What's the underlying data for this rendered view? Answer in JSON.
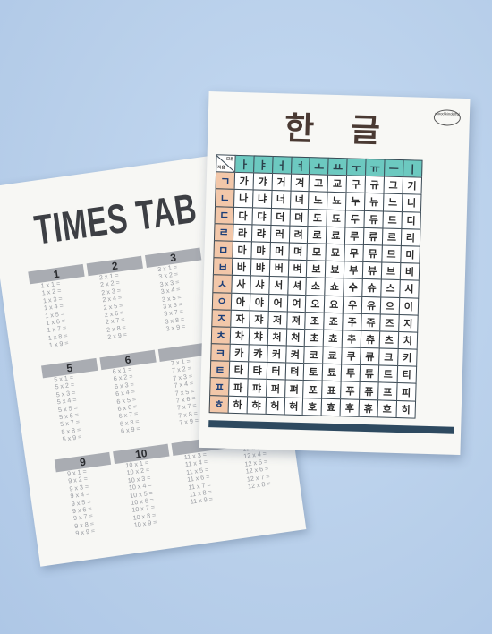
{
  "times_table": {
    "title": "TIMES TAB",
    "sections": [
      {
        "header": "1",
        "lines": [
          "1 x 1 =",
          "1 x 2 =",
          "1 x 3 =",
          "1 x 4 =",
          "1 x 5 =",
          "1 x 6 =",
          "1 x 7 =",
          "1 x 8 =",
          "1 x 9 ="
        ]
      },
      {
        "header": "2",
        "lines": [
          "2 x 1 =",
          "2 x 2 =",
          "2 x 3 =",
          "2 x 4 =",
          "2 x 5 =",
          "2 x 6 =",
          "2 x 7 =",
          "2 x 8 =",
          "2 x 9 ="
        ]
      },
      {
        "header": "3",
        "lines": [
          "3 x 1 =",
          "3 x 2 =",
          "3 x 3 =",
          "3 x 4 =",
          "3 x 5 =",
          "3 x 6 =",
          "3 x 7 =",
          "3 x 8 =",
          "3 x 9 ="
        ]
      },
      {
        "header": "5",
        "lines": [
          "5 x 1 =",
          "5 x 2 =",
          "5 x 3 =",
          "5 x 4 =",
          "5 x 5 =",
          "5 x 6 =",
          "5 x 7 =",
          "5 x 8 =",
          "5 x 9 ="
        ]
      },
      {
        "header": "6",
        "lines": [
          "6 x 1 =",
          "6 x 2 =",
          "6 x 3 =",
          "6 x 4 =",
          "6 x 5 =",
          "6 x 6 =",
          "6 x 7 =",
          "6 x 8 =",
          "6 x 9 ="
        ]
      },
      {
        "header": "",
        "lines": [
          "7 x 1 =",
          "7 x 2 =",
          "7 x 3 =",
          "7 x 4 =",
          "7 x 5 =",
          "7 x 6 =",
          "7 x 7 =",
          "7 x 8 =",
          "7 x 9 ="
        ]
      },
      {
        "header": "9",
        "lines": [
          "9 x 1 =",
          "9 x 2 =",
          "9 x 3 =",
          "9 x 4 =",
          "9 x 5 =",
          "9 x 6 =",
          "9 x 7 =",
          "9 x 8 =",
          "9 x 9 ="
        ]
      },
      {
        "header": "10",
        "lines": [
          "10 x 1 =",
          "10 x 2 =",
          "10 x 3 =",
          "10 x 4 =",
          "10 x 5 =",
          "10 x 6 =",
          "10 x 7 =",
          "10 x 8 =",
          "10 x 9 ="
        ]
      },
      {
        "header": "",
        "lines": [
          "11 x 3 =",
          "11 x 4 =",
          "11 x 5 =",
          "11 x 6 =",
          "11 x 7 =",
          "11 x 8 =",
          "11 x 9 ="
        ]
      },
      {
        "header": "",
        "lines": [
          "12 x 3 =",
          "12 x 4 =",
          "12 x 5 =",
          "12 x 6 =",
          "12 x 7 =",
          "12 x 8 ="
        ]
      }
    ]
  },
  "hangul_chart": {
    "title": "한 글",
    "logo": "mood kinderful",
    "corner_vowel_label": "모음",
    "corner_consonant_label": "자음",
    "vowels": [
      "ㅏ",
      "ㅑ",
      "ㅓ",
      "ㅕ",
      "ㅗ",
      "ㅛ",
      "ㅜ",
      "ㅠ",
      "ㅡ",
      "ㅣ"
    ],
    "rows": [
      {
        "consonant": "ㄱ",
        "syllables": [
          "가",
          "갸",
          "거",
          "겨",
          "고",
          "교",
          "구",
          "규",
          "그",
          "기"
        ]
      },
      {
        "consonant": "ㄴ",
        "syllables": [
          "나",
          "냐",
          "너",
          "녀",
          "노",
          "뇨",
          "누",
          "뉴",
          "느",
          "니"
        ]
      },
      {
        "consonant": "ㄷ",
        "syllables": [
          "다",
          "댜",
          "더",
          "뎌",
          "도",
          "됴",
          "두",
          "듀",
          "드",
          "디"
        ]
      },
      {
        "consonant": "ㄹ",
        "syllables": [
          "라",
          "랴",
          "러",
          "려",
          "로",
          "료",
          "루",
          "류",
          "르",
          "리"
        ]
      },
      {
        "consonant": "ㅁ",
        "syllables": [
          "마",
          "먀",
          "머",
          "며",
          "모",
          "묘",
          "무",
          "뮤",
          "므",
          "미"
        ]
      },
      {
        "consonant": "ㅂ",
        "syllables": [
          "바",
          "뱌",
          "버",
          "벼",
          "보",
          "뵤",
          "부",
          "뷰",
          "브",
          "비"
        ]
      },
      {
        "consonant": "ㅅ",
        "syllables": [
          "사",
          "샤",
          "서",
          "셔",
          "소",
          "쇼",
          "수",
          "슈",
          "스",
          "시"
        ]
      },
      {
        "consonant": "ㅇ",
        "syllables": [
          "아",
          "야",
          "어",
          "여",
          "오",
          "요",
          "우",
          "유",
          "으",
          "이"
        ]
      },
      {
        "consonant": "ㅈ",
        "syllables": [
          "자",
          "쟈",
          "저",
          "져",
          "조",
          "죠",
          "주",
          "쥬",
          "즈",
          "지"
        ]
      },
      {
        "consonant": "ㅊ",
        "syllables": [
          "차",
          "챠",
          "처",
          "쳐",
          "초",
          "쵸",
          "추",
          "츄",
          "츠",
          "치"
        ]
      },
      {
        "consonant": "ㅋ",
        "syllables": [
          "카",
          "캬",
          "커",
          "켜",
          "코",
          "쿄",
          "쿠",
          "큐",
          "크",
          "키"
        ]
      },
      {
        "consonant": "ㅌ",
        "syllables": [
          "타",
          "탸",
          "터",
          "텨",
          "토",
          "툐",
          "투",
          "튜",
          "트",
          "티"
        ]
      },
      {
        "consonant": "ㅍ",
        "syllables": [
          "파",
          "퍄",
          "퍼",
          "펴",
          "포",
          "표",
          "푸",
          "퓨",
          "프",
          "피"
        ]
      },
      {
        "consonant": "ㅎ",
        "syllables": [
          "하",
          "햐",
          "허",
          "혀",
          "호",
          "효",
          "후",
          "휴",
          "흐",
          "히"
        ]
      }
    ]
  },
  "colors": {
    "background": "#bdd3ee",
    "vowel_header": "#6cc9c0",
    "consonant_column": "#f2c7a9",
    "hangul_title": "#4a3a33",
    "times_header": "#a9acb2"
  }
}
